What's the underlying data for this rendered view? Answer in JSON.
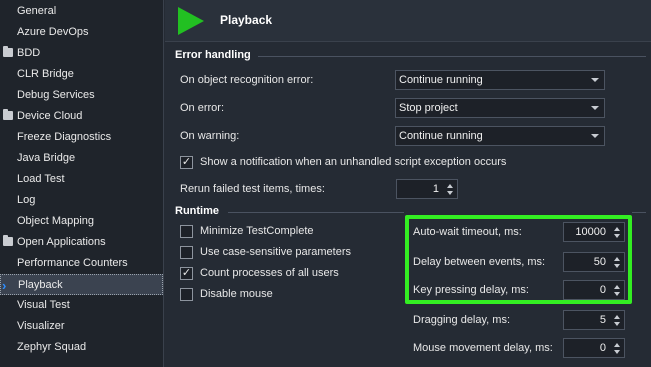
{
  "sidebar": {
    "items": [
      {
        "label": "General",
        "folder": false,
        "selected": false
      },
      {
        "label": "Azure DevOps",
        "folder": false,
        "selected": false
      },
      {
        "label": "BDD",
        "folder": true,
        "selected": false
      },
      {
        "label": "CLR Bridge",
        "folder": false,
        "selected": false
      },
      {
        "label": "Debug Services",
        "folder": false,
        "selected": false
      },
      {
        "label": "Device Cloud",
        "folder": true,
        "selected": false
      },
      {
        "label": "Freeze Diagnostics",
        "folder": false,
        "selected": false
      },
      {
        "label": "Java Bridge",
        "folder": false,
        "selected": false
      },
      {
        "label": "Load Test",
        "folder": false,
        "selected": false
      },
      {
        "label": "Log",
        "folder": false,
        "selected": false
      },
      {
        "label": "Object Mapping",
        "folder": false,
        "selected": false
      },
      {
        "label": "Open Applications",
        "folder": true,
        "selected": false
      },
      {
        "label": "Performance Counters",
        "folder": false,
        "selected": false
      },
      {
        "label": "Playback",
        "folder": false,
        "selected": true
      },
      {
        "label": "Visual Test",
        "folder": false,
        "selected": false
      },
      {
        "label": "Visualizer",
        "folder": false,
        "selected": false
      },
      {
        "label": "Zephyr Squad",
        "folder": false,
        "selected": false
      }
    ]
  },
  "header": {
    "title": "Playback",
    "icon": "play-icon",
    "icon_color": "#22c022"
  },
  "error_handling": {
    "title": "Error handling",
    "object_recognition_label": "On object recognition error:",
    "object_recognition_value": "Continue running",
    "on_error_label": "On error:",
    "on_error_value": "Stop project",
    "on_warning_label": "On warning:",
    "on_warning_value": "Continue running",
    "notification_label": "Show a notification when an unhandled script exception occurs",
    "notification_checked": true,
    "rerun_label": "Rerun failed test items, times:",
    "rerun_value": "1"
  },
  "runtime": {
    "title": "Runtime",
    "checkboxes": [
      {
        "label": "Minimize TestComplete",
        "checked": false
      },
      {
        "label": "Use case-sensitive parameters",
        "checked": false
      },
      {
        "label": "Count processes of all users",
        "checked": true
      },
      {
        "label": "Disable mouse",
        "checked": false
      }
    ],
    "delays": [
      {
        "label": "Auto-wait timeout, ms:",
        "value": "10000"
      },
      {
        "label": "Delay between events, ms:",
        "value": "50"
      },
      {
        "label": "Key pressing delay, ms:",
        "value": "0"
      },
      {
        "label": "Dragging delay, ms:",
        "value": "5"
      },
      {
        "label": "Mouse movement delay, ms:",
        "value": "0"
      }
    ]
  },
  "colors": {
    "highlight": "#33ee22",
    "background": "#252b34",
    "sidebar": "#1f242b",
    "selection_chevron": "#2f8fff"
  }
}
